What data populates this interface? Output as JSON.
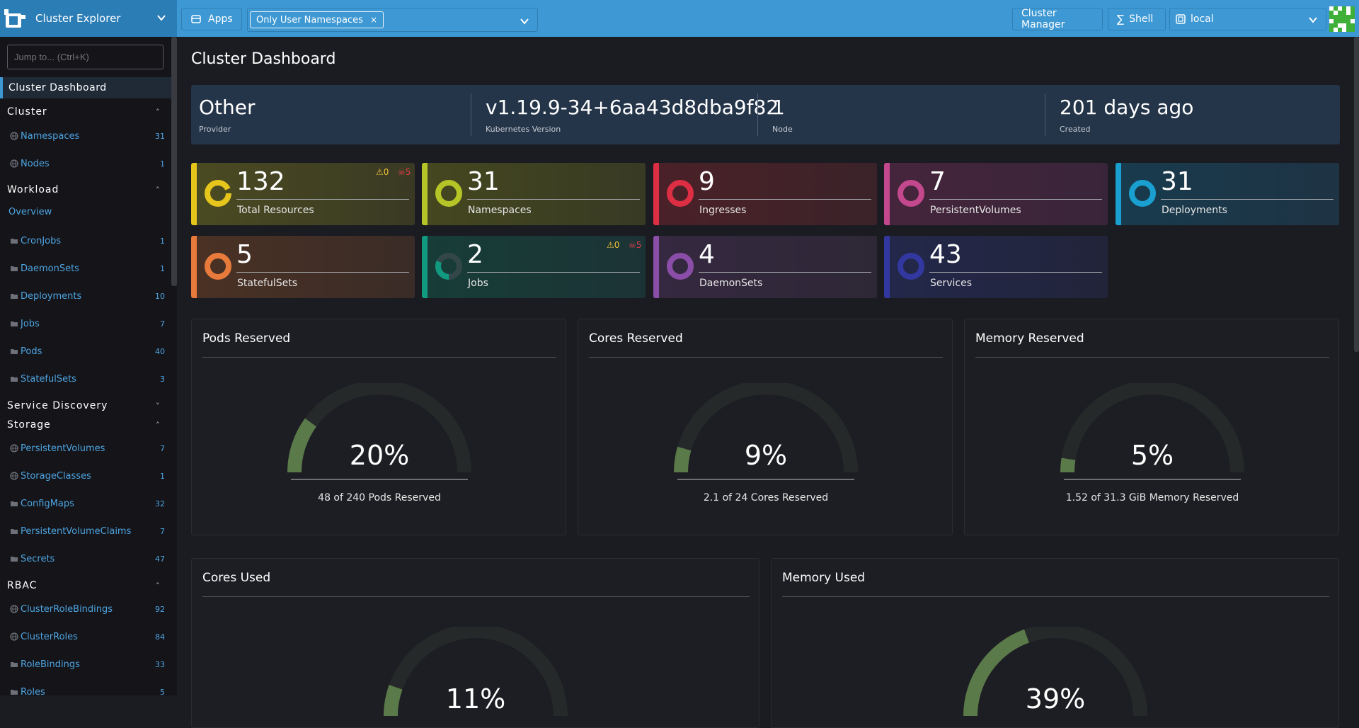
{
  "topbar": {
    "brand_title": "Cluster Explorer",
    "apps_label": "Apps",
    "namespace_filter": "Only User Namespaces",
    "namespace_remove": "×",
    "cluster_manager_label": "Cluster Manager",
    "shell_label": "Shell",
    "cluster_select": "local"
  },
  "sidebar": {
    "search_placeholder": "Jump to... (Ctrl+K)",
    "active_item": "Cluster Dashboard",
    "groups": {
      "cluster": "Cluster",
      "workload": "Workload",
      "service_discovery": "Service Discovery",
      "storage": "Storage",
      "rbac": "RBAC"
    },
    "workload_overview": "Overview",
    "items": [
      {
        "label": "Namespaces",
        "count": "31",
        "icon": "globe-icon"
      },
      {
        "label": "Nodes",
        "count": "1",
        "icon": "globe-icon"
      },
      {
        "label": "CronJobs",
        "count": "1",
        "icon": "folder-icon"
      },
      {
        "label": "DaemonSets",
        "count": "1",
        "icon": "folder-icon"
      },
      {
        "label": "Deployments",
        "count": "10",
        "icon": "folder-icon"
      },
      {
        "label": "Jobs",
        "count": "7",
        "icon": "folder-icon"
      },
      {
        "label": "Pods",
        "count": "40",
        "icon": "folder-icon"
      },
      {
        "label": "StatefulSets",
        "count": "3",
        "icon": "folder-icon"
      },
      {
        "label": "PersistentVolumes",
        "count": "7",
        "icon": "globe-icon"
      },
      {
        "label": "StorageClasses",
        "count": "1",
        "icon": "globe-icon"
      },
      {
        "label": "ConfigMaps",
        "count": "32",
        "icon": "folder-icon"
      },
      {
        "label": "PersistentVolumeClaims",
        "count": "7",
        "icon": "folder-icon"
      },
      {
        "label": "Secrets",
        "count": "47",
        "icon": "folder-icon"
      },
      {
        "label": "ClusterRoleBindings",
        "count": "92",
        "icon": "globe-icon"
      },
      {
        "label": "ClusterRoles",
        "count": "84",
        "icon": "globe-icon"
      },
      {
        "label": "RoleBindings",
        "count": "33",
        "icon": "folder-icon"
      },
      {
        "label": "Roles",
        "count": "5",
        "icon": "folder-icon"
      }
    ]
  },
  "main": {
    "title": "Cluster Dashboard",
    "summary": [
      {
        "value": "Other",
        "label": "Provider"
      },
      {
        "value": "v1.19.9-34+6aa43d8dba9f82",
        "label": "Kubernetes Version"
      },
      {
        "value": "1",
        "label": "Node"
      },
      {
        "value": "201 days ago",
        "label": "Created"
      }
    ],
    "cards": [
      {
        "value": "132",
        "label": "Total Resources",
        "color": "#e6c51c",
        "warn": "0",
        "err": "5"
      },
      {
        "value": "31",
        "label": "Namespaces",
        "color": "#b5c427"
      },
      {
        "value": "9",
        "label": "Ingresses",
        "color": "#dc2f43"
      },
      {
        "value": "7",
        "label": "PersistentVolumes",
        "color": "#c3488d"
      },
      {
        "value": "31",
        "label": "Deployments",
        "color": "#1aa0d0"
      },
      {
        "value": "5",
        "label": "StatefulSets",
        "color": "#e87b3b"
      },
      {
        "value": "2",
        "label": "Jobs",
        "color": "#119a80",
        "warn": "0",
        "err": "5"
      },
      {
        "value": "4",
        "label": "DaemonSets",
        "color": "#8a4ea8"
      },
      {
        "value": "43",
        "label": "Services",
        "color": "#3238a0"
      }
    ],
    "gauges": [
      {
        "title": "Pods Reserved",
        "percent": "20%",
        "fraction": 0.2,
        "caption": "48 of 240 Pods Reserved"
      },
      {
        "title": "Cores Reserved",
        "percent": "9%",
        "fraction": 0.09,
        "caption": "2.1 of 24 Cores Reserved"
      },
      {
        "title": "Memory Reserved",
        "percent": "5%",
        "fraction": 0.05,
        "caption": "1.52 of 31.3 GiB Memory Reserved"
      },
      {
        "title": "Cores Used",
        "percent": "11%",
        "fraction": 0.11
      },
      {
        "title": "Memory Used",
        "percent": "39%",
        "fraction": 0.39
      }
    ]
  },
  "colors": {
    "topbar": "#3d98d3",
    "accent": "#4ea4e0",
    "gauge_fill": "#5b7a4a",
    "gauge_track": "#26292a",
    "warn": "#f2c33a",
    "error": "#e33f4b"
  }
}
